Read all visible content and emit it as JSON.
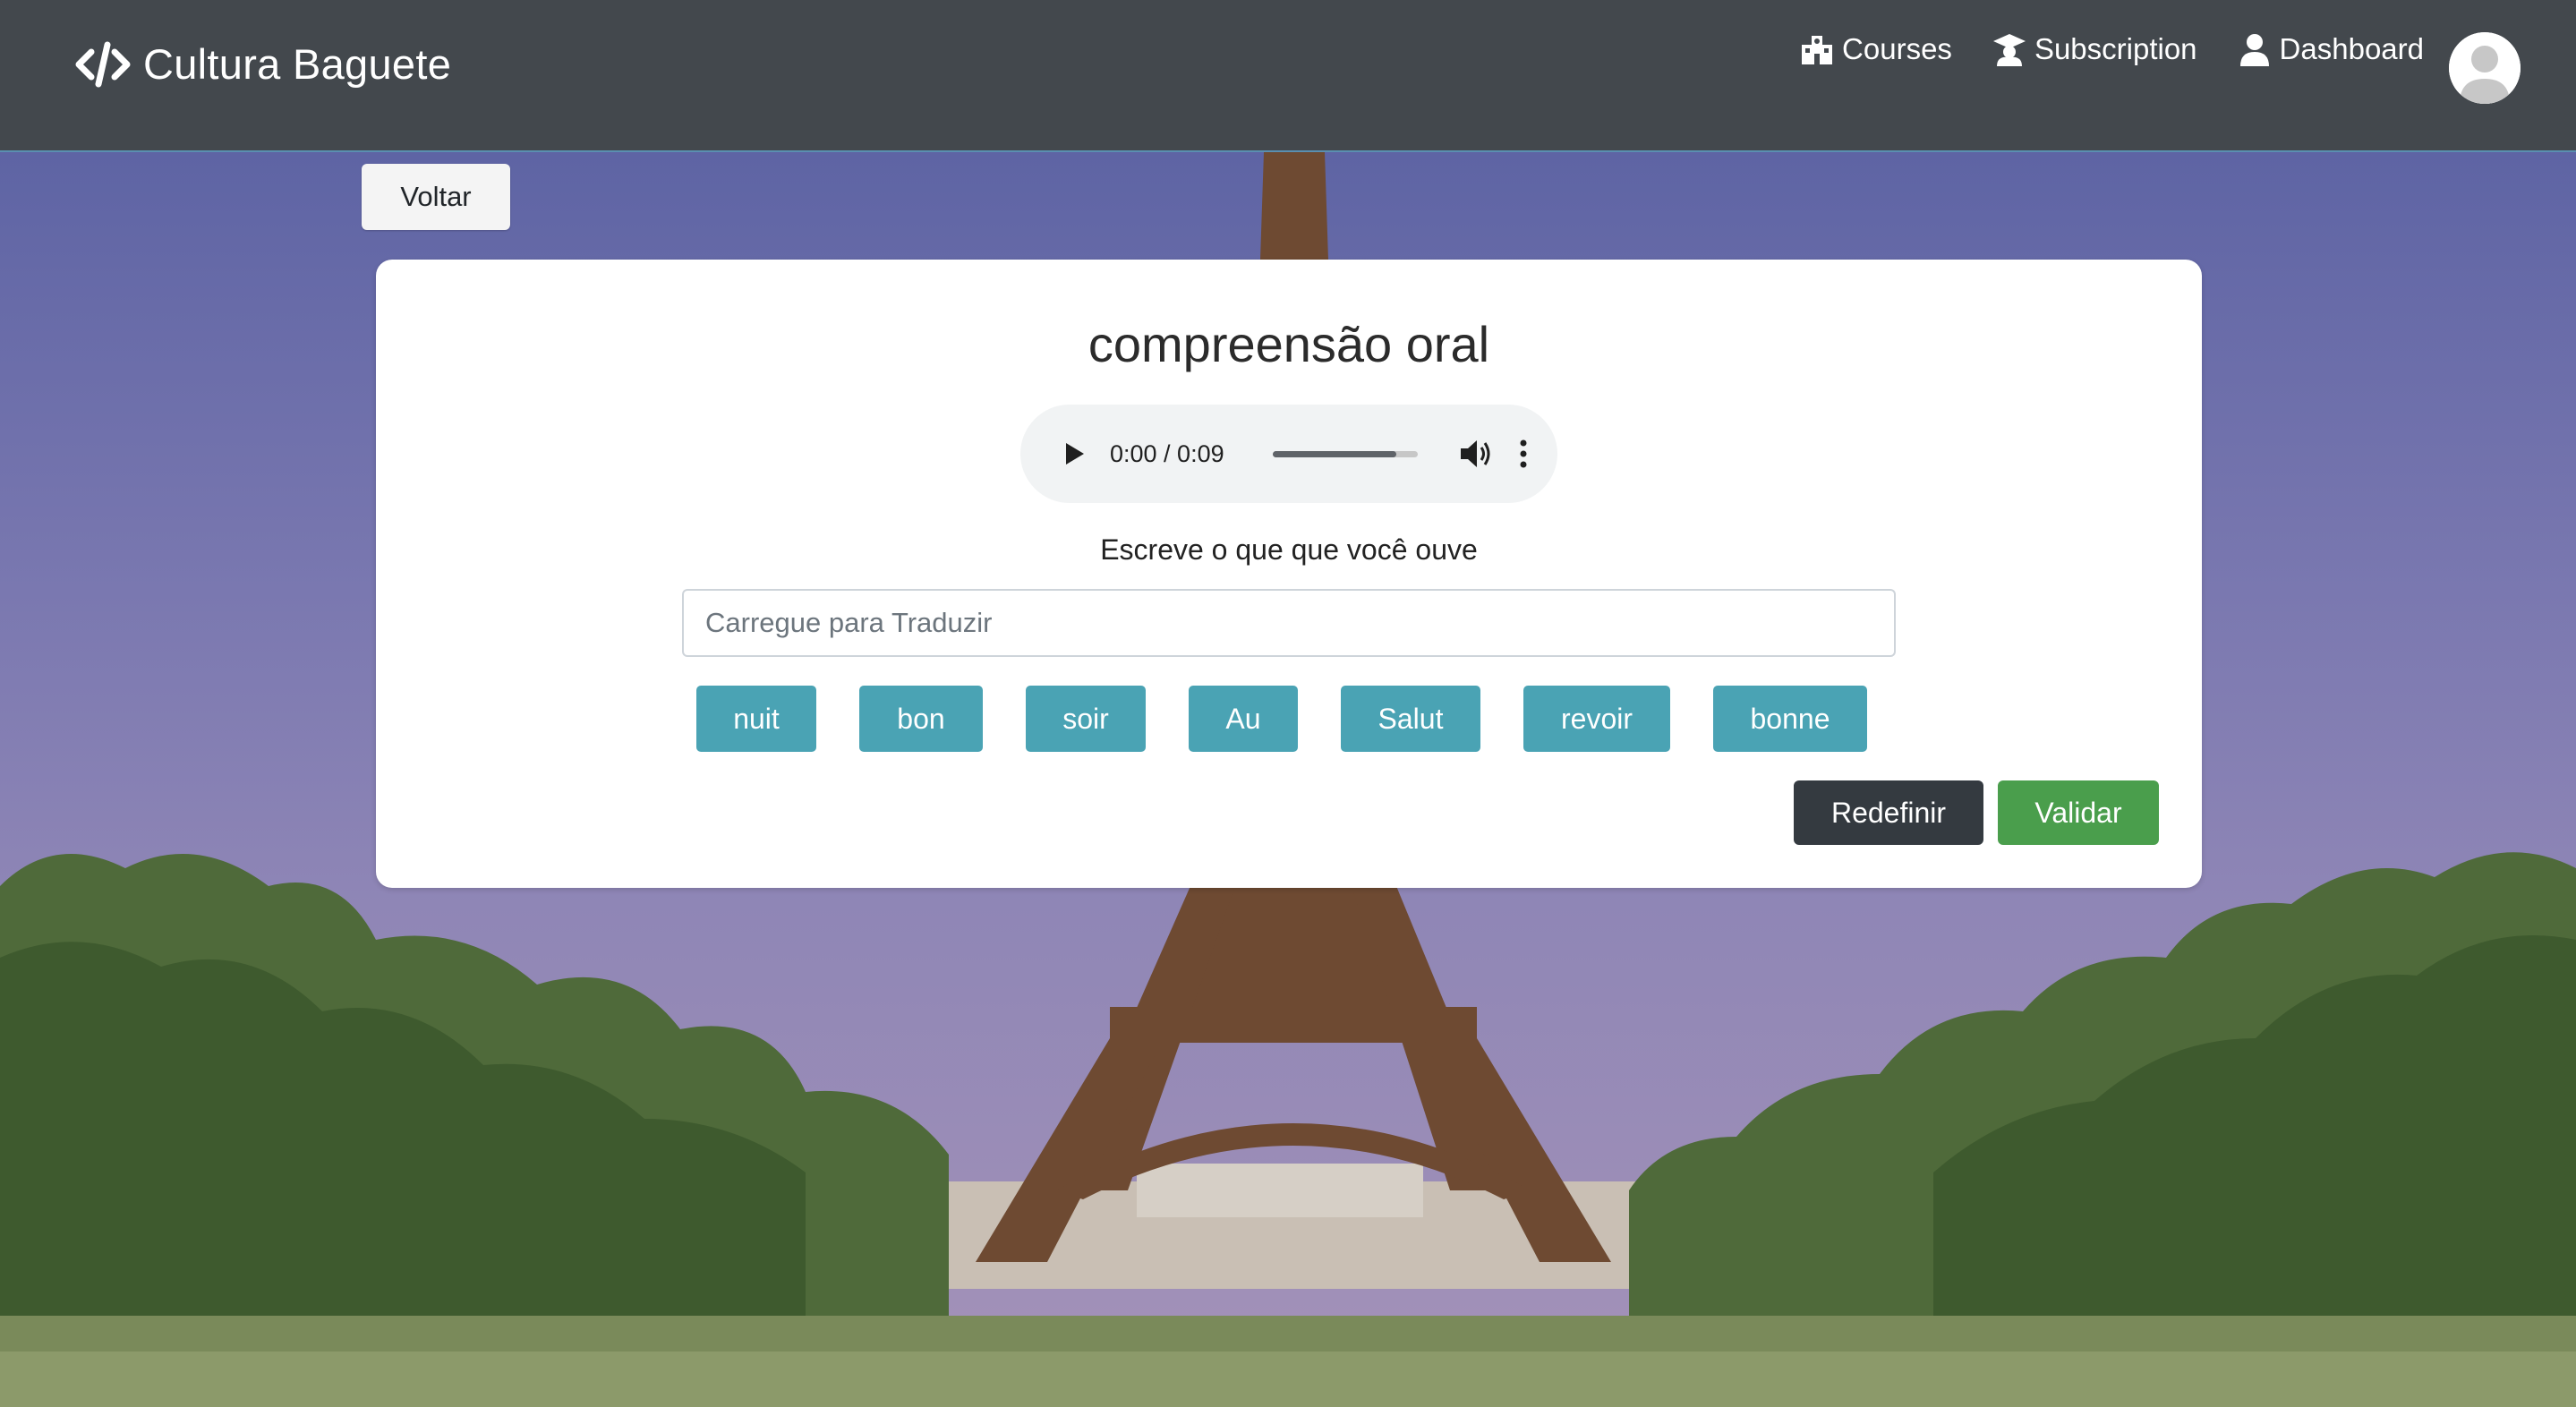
{
  "navbar": {
    "brand": "Cultura Baguete",
    "links": [
      {
        "label": "Courses",
        "icon": "school-building-icon"
      },
      {
        "label": "Subscription",
        "icon": "graduate-icon"
      },
      {
        "label": "Dashboard",
        "icon": "user-icon"
      }
    ],
    "avatar_icon": "user-avatar-icon"
  },
  "back_button": "Voltar",
  "exercise": {
    "title": "compreensão oral",
    "audio": {
      "time": "0:00 / 0:09",
      "buffered_fraction": 0.85
    },
    "instruction": "Escreve o que que você ouve",
    "input_placeholder": "Carregue para Traduzir",
    "input_value": "",
    "words": [
      "nuit",
      "bon",
      "soir",
      "Au",
      "Salut",
      "revoir",
      "bonne"
    ],
    "reset_label": "Redefinir",
    "validate_label": "Validar"
  },
  "colors": {
    "navbar": "#43484d",
    "word_button": "#4aa3b4",
    "reset_button": "#343a40",
    "validate_button": "#4a9e4c"
  }
}
